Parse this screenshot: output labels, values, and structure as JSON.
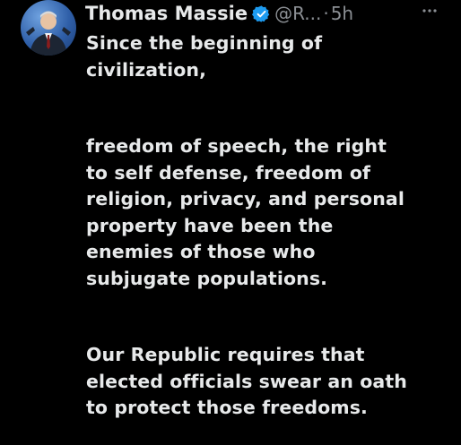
{
  "author": {
    "name": "Thomas Massie",
    "handle": "@R...",
    "separator": "·",
    "time": "5h"
  },
  "icons": {
    "verified": "verified-badge-icon",
    "more": "more-options-icon"
  },
  "colors": {
    "background": "#000000",
    "text": "#e7e9ea",
    "secondary": "#8b8f94",
    "verified": "#1d9bf0"
  },
  "tweet": {
    "paragraph1": [
      "Since the beginning of",
      "civilization,"
    ],
    "paragraph2": [
      "freedom of speech, the right",
      "to self defense, freedom of",
      "religion, privacy, and personal",
      "property have been the",
      "enemies of those who",
      "subjugate populations."
    ],
    "paragraph3": [
      "Our Republic requires that",
      "elected officials swear an oath",
      "to protect those freedoms."
    ]
  }
}
